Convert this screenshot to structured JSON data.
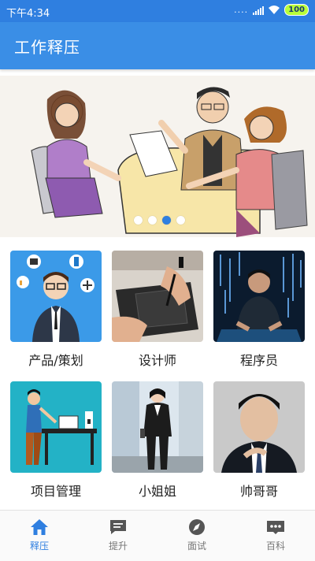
{
  "status_bar": {
    "time": "下午4:34",
    "dots": "....",
    "battery": "100"
  },
  "app_bar": {
    "title": "工作释压"
  },
  "banner": {
    "page_count": 4,
    "active_page": 3
  },
  "categories": [
    {
      "label": "产品/策划",
      "image": "product-manager-illustration"
    },
    {
      "label": "设计师",
      "image": "drawing-tablet-photo"
    },
    {
      "label": "程序员",
      "image": "programmer-photo"
    },
    {
      "label": "项目管理",
      "image": "project-manager-illustration"
    },
    {
      "label": "小姐姐",
      "image": "woman-in-suit-photo"
    },
    {
      "label": "帅哥哥",
      "image": "man-in-suit-photo"
    }
  ],
  "tabs": [
    {
      "label": "释压",
      "icon": "home-icon",
      "active": true
    },
    {
      "label": "提升",
      "icon": "chat-icon",
      "active": false
    },
    {
      "label": "面试",
      "icon": "compass-icon",
      "active": false
    },
    {
      "label": "百科",
      "icon": "more-icon",
      "active": false
    }
  ],
  "colors": {
    "primary": "#3a8ee6",
    "active_tab": "#2f7fe0"
  }
}
